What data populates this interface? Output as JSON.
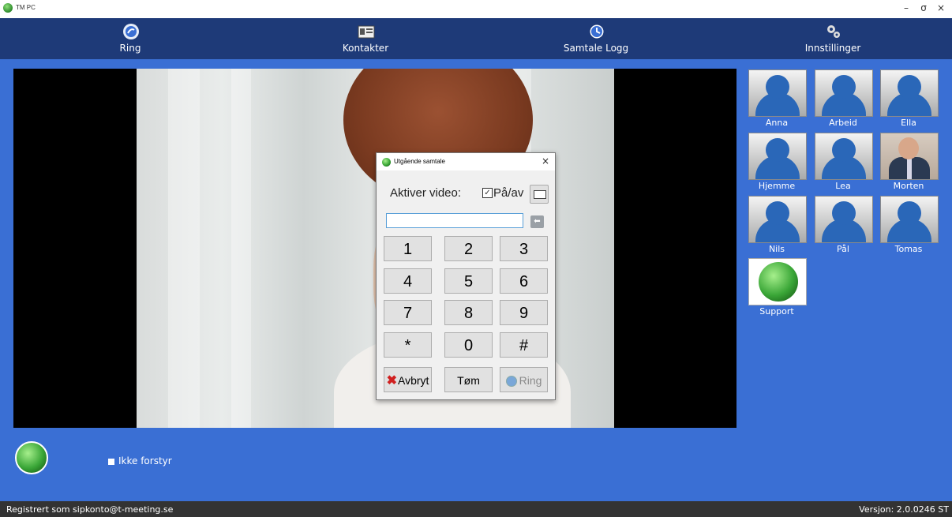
{
  "window": {
    "title": "TM PC",
    "minimize": "–",
    "maximize": "σ",
    "close": "×"
  },
  "nav": [
    {
      "label": "Ring",
      "icon": "ring-globe-icon"
    },
    {
      "label": "Kontakter",
      "icon": "contacts-card-icon"
    },
    {
      "label": "Samtale Logg",
      "icon": "clock-icon"
    },
    {
      "label": "Innstillinger",
      "icon": "gears-icon"
    }
  ],
  "contacts": [
    {
      "name": "Anna",
      "icon": "person-icon"
    },
    {
      "name": "Arbeid",
      "icon": "person-icon"
    },
    {
      "name": "Ella",
      "icon": "person-icon"
    },
    {
      "name": "Hjemme",
      "icon": "person-icon"
    },
    {
      "name": "Lea",
      "icon": "person-icon"
    },
    {
      "name": "Morten",
      "icon": "photo"
    },
    {
      "name": "Nils",
      "icon": "person-icon"
    },
    {
      "name": "Pål",
      "icon": "person-icon"
    },
    {
      "name": "Tomas",
      "icon": "person-icon"
    },
    {
      "name": "Support",
      "icon": "globe-icon"
    }
  ],
  "dialog": {
    "title": "Utgående samtale",
    "video_label": "Aktiver video:",
    "video_checkbox_label": "På/av",
    "video_checked": true,
    "number_value": "",
    "keys": [
      "1",
      "2",
      "3",
      "4",
      "5",
      "6",
      "7",
      "8",
      "9",
      "*",
      "0",
      "#"
    ],
    "cancel_label": "Avbryt",
    "clear_label": "Tøm",
    "ring_label": "Ring"
  },
  "dnd": {
    "label": "Ikke forstyr",
    "checked": false
  },
  "status": {
    "left": "Registrert som sipkonto@t-meeting.se",
    "right": "Versjon: 2.0.0246 ST"
  },
  "colors": {
    "background": "#3a6fd4",
    "nav": "#1e3a78",
    "statusbar": "#333333"
  }
}
